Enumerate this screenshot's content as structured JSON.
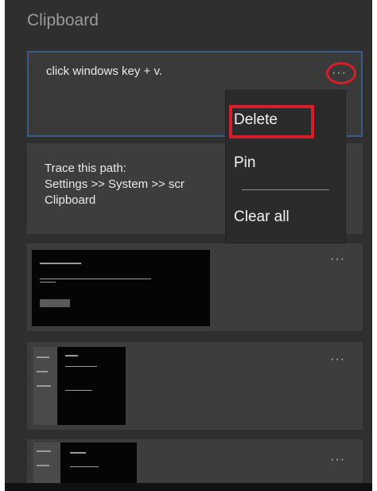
{
  "panel": {
    "title": "Clipboard"
  },
  "items": [
    {
      "text": "click windows key + v.",
      "more": "···"
    },
    {
      "text": "Trace this path:\nSettings >> System >> scr\nClipboard",
      "more": "···"
    },
    {
      "thumbnail": "screenshot",
      "more": "···"
    },
    {
      "thumbnail": "screenshot",
      "more": "···"
    },
    {
      "thumbnail": "screenshot",
      "more": "···"
    }
  ],
  "context_menu": {
    "items": [
      {
        "label": "Delete"
      },
      {
        "label": "Pin"
      },
      {
        "label": "Clear all"
      }
    ]
  },
  "colors": {
    "panel_bg": "#2f2f2f",
    "card_bg": "#3d3d3d",
    "selected_border": "#3a5c86",
    "annotation_red": "#d81e2a"
  }
}
